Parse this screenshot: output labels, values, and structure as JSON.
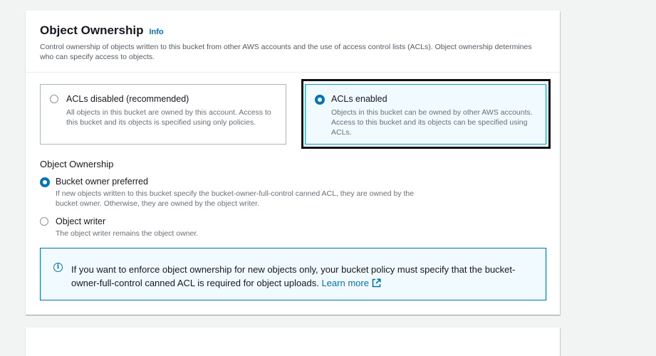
{
  "section": {
    "title": "Object Ownership",
    "info_link": "Info",
    "description": "Control ownership of objects written to this bucket from other AWS accounts and the use of access control lists (ACLs). Object ownership determines who can specify access to objects."
  },
  "acl_tiles": [
    {
      "label": "ACLs disabled (recommended)",
      "description": "All objects in this bucket are owned by this account. Access to this bucket and its objects is specified using only policies.",
      "selected": false
    },
    {
      "label": "ACLs enabled",
      "description": "Objects in this bucket can be owned by other AWS accounts. Access to this bucket and its objects can be specified using ACLs.",
      "selected": true
    }
  ],
  "ownership": {
    "label": "Object Ownership",
    "options": [
      {
        "label": "Bucket owner preferred",
        "description": "If new objects written to this bucket specify the bucket-owner-full-control canned ACL, they are owned by the bucket owner. Otherwise, they are owned by the object writer.",
        "selected": true
      },
      {
        "label": "Object writer",
        "description": "The object writer remains the object owner.",
        "selected": false
      }
    ]
  },
  "alert": {
    "icon": "info-icon",
    "text": "If you want to enforce object ownership for new objects only, your bucket policy must specify that the bucket-owner-full-control canned ACL is required for object uploads.",
    "link": "Learn more",
    "link_icon": "external-link-icon"
  },
  "colors": {
    "accent": "#0073bb",
    "selected_tile_bg": "#f1faff",
    "selected_tile_border": "#00a1c9"
  }
}
